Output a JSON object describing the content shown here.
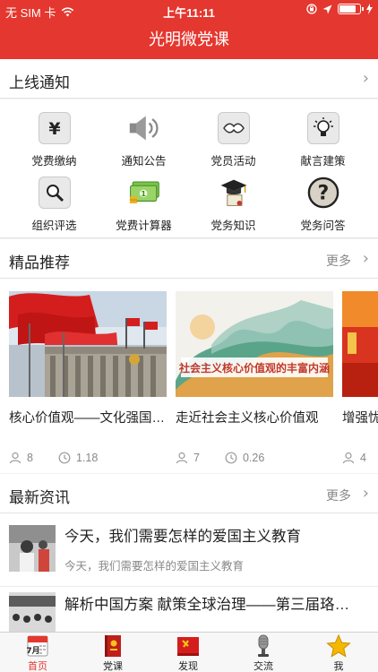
{
  "status_bar": {
    "carrier": "无 SIM 卡",
    "time": "上午11:11",
    "battery_level": 0.8
  },
  "nav": {
    "title": "光明微党课"
  },
  "notice": {
    "label": "上线通知"
  },
  "grid": [
    {
      "label": "党费缴纳",
      "icon": "yuan-icon"
    },
    {
      "label": "通知公告",
      "icon": "speaker-icon"
    },
    {
      "label": "党员活动",
      "icon": "handshake-icon"
    },
    {
      "label": "献言建策",
      "icon": "lightbulb-icon"
    },
    {
      "label": "组织评选",
      "icon": "magnifier-icon"
    },
    {
      "label": "党费计算器",
      "icon": "money-icon"
    },
    {
      "label": "党务知识",
      "icon": "graduation-icon"
    },
    {
      "label": "党务问答",
      "icon": "question-icon"
    }
  ],
  "featured": {
    "title": "精品推荐",
    "more": "更多",
    "cards": [
      {
        "title": "核心价值观——文化强国…",
        "views": "8",
        "duration": "1.18"
      },
      {
        "title": "走近社会主义核心价值观",
        "views": "7",
        "duration": "0.26",
        "banner": "社会主义核心价值观的丰富内涵"
      },
      {
        "title": "增强忧",
        "views": "4",
        "duration": ""
      }
    ]
  },
  "news": {
    "title": "最新资讯",
    "more": "更多",
    "items": [
      {
        "title": "今天，我们需要怎样的爱国主义教育",
        "subtitle": "今天，我们需要怎样的爱国主义教育"
      },
      {
        "title": "解析中国方案 献策全球治理——第三届珞…",
        "subtitle": ""
      }
    ]
  },
  "tabs": [
    {
      "label": "首页",
      "icon": "calendar-icon",
      "badge": "7月",
      "active": true
    },
    {
      "label": "党课",
      "icon": "book-icon",
      "active": false
    },
    {
      "label": "发现",
      "icon": "party-flag-icon",
      "active": false
    },
    {
      "label": "交流",
      "icon": "microphone-icon",
      "active": false
    },
    {
      "label": "我",
      "icon": "star-icon",
      "active": false
    }
  ],
  "colors": {
    "brand": "#e4372f",
    "text": "#222222",
    "muted": "#888888"
  }
}
